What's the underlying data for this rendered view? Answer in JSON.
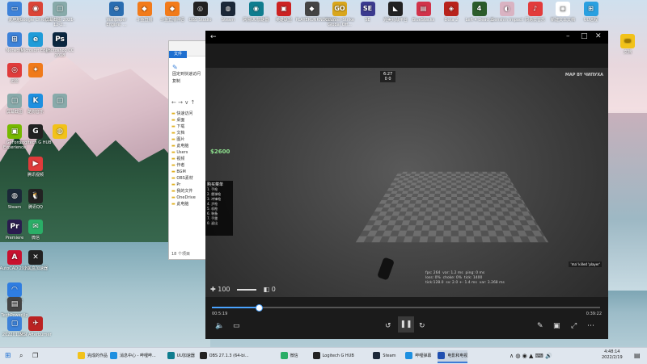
{
  "desktop": {
    "left_icons": [
      {
        "label": "此电脑",
        "color": "#3d82d9",
        "glyph": "▭"
      },
      {
        "label": "Google Chrome",
        "color": "#db4437",
        "glyph": "◉"
      },
      {
        "label": "屏幕截图 2021-12-2...",
        "color": "#8aa",
        "glyph": "▢"
      },
      {
        "label": "Network",
        "color": "#3d82d9",
        "glyph": "⊞"
      },
      {
        "label": "Microsoft Edge",
        "color": "#1f9cd9",
        "glyph": "e"
      },
      {
        "label": "Photoshop CC 2018",
        "color": "#0b2740",
        "glyph": "Ps"
      },
      {
        "label": "迅雷",
        "color": "#e03b3b",
        "glyph": "◎"
      },
      {
        "label": "屏幕截图",
        "color": "#8aa",
        "glyph": "▢"
      },
      {
        "label": "",
        "color": "#f07a1a",
        "glyph": "✦"
      },
      {
        "label": "酷狗音乐",
        "color": "#1e90e0",
        "glyph": "K"
      },
      {
        "label": "",
        "color": "#8aa",
        "glyph": "▢"
      },
      {
        "label": "GeForce Experience",
        "color": "#76b900",
        "glyph": "▣"
      },
      {
        "label": "",
        "color": "#f2c21a",
        "glyph": "◍"
      },
      {
        "label": "腾讯视频",
        "color": "#e03b3b",
        "glyph": "▶"
      },
      {
        "label": "Logitech G HUB",
        "color": "#222",
        "glyph": "G"
      },
      {
        "label": "Steam",
        "color": "#1b2838",
        "glyph": "◍"
      },
      {
        "label": "腾讯QQ",
        "color": "#222",
        "glyph": "🐧"
      },
      {
        "label": "Premiere",
        "color": "#2a1c4f",
        "glyph": "Pr"
      },
      {
        "label": "微信",
        "color": "#2aae67",
        "glyph": "✉"
      },
      {
        "label": "AutoCAD 2020",
        "color": "#c8102e",
        "glyph": "A"
      },
      {
        "label": "小黑盒加速器",
        "color": "#222",
        "glyph": "✕"
      },
      {
        "label": "百度网盘",
        "color": "#2f7de1",
        "glyph": "◠"
      },
      {
        "label": "TechPowerUp GPU-Z",
        "color": "#444",
        "glyph": "▤"
      },
      {
        "label": "20220119...",
        "color": "#3d82d9",
        "glyph": "▢"
      },
      {
        "label": "MSI Afterburner",
        "color": "#b22",
        "glyph": "✈"
      }
    ],
    "top_icons": [
      {
        "label": "Wallpaper Engine: ...",
        "color": "#2a6db0",
        "glyph": "⊕"
      },
      {
        "label": "斗鱼直播",
        "color": "#f27b1a",
        "glyph": "◆"
      },
      {
        "label": "斗鱼直播伴侣",
        "color": "#f27b1a",
        "glyph": "◆"
      },
      {
        "label": "OBS Studio",
        "color": "#222",
        "glyph": "◎"
      },
      {
        "label": "Steam",
        "color": "#1b2838",
        "glyph": "◍"
      },
      {
        "label": "网易UU加速器",
        "color": "#0f7d8f",
        "glyph": "◉"
      },
      {
        "label": "英雄联盟",
        "color": "#c22",
        "glyph": "▣"
      },
      {
        "label": "PLAYERUNKNOWN'S",
        "color": "#444",
        "glyph": "◆"
      },
      {
        "label": "Counter-Strike Global Off...",
        "color": "#d9a61c",
        "glyph": "GO"
      },
      {
        "label": "SE",
        "color": "#3b3b8f",
        "glyph": "SE"
      },
      {
        "label": "完美对战平台",
        "color": "#222",
        "glyph": "◣"
      },
      {
        "label": "BlueStacks",
        "color": "#d1334a",
        "glyph": "▤"
      },
      {
        "label": "Dota 2",
        "color": "#b8231c",
        "glyph": "◈"
      },
      {
        "label": "Left 4 Dead 2",
        "color": "#2b5c2b",
        "glyph": "4"
      },
      {
        "label": "Genshin Impact",
        "color": "#d9b3c2",
        "glyph": "◐"
      },
      {
        "label": "网易云音乐",
        "color": "#e23b3b",
        "glyph": "♪"
      },
      {
        "label": "新建文本文档",
        "color": "#fff",
        "glyph": "▢"
      },
      {
        "label": "UU远程",
        "color": "#2aa0e0",
        "glyph": "⊞"
      }
    ],
    "right_icon": {
      "label": "文档",
      "color": "#f2c21a",
      "glyph": "▬"
    }
  },
  "explorer": {
    "tab_label": "文件",
    "ribbon_items": [
      "固定到快速访问",
      "复制"
    ],
    "tree": [
      "快速访问",
      "桌面",
      "下载",
      "文档",
      "图片",
      "此电脑",
      "Users",
      "视频",
      "作者",
      "BGM",
      "OBS素材",
      "Pr",
      "我的文件",
      "OneDrive",
      "此电脑"
    ],
    "status": "18 个项目"
  },
  "player": {
    "hud_score": "6:27",
    "hud_score2": "0    0",
    "map_label": "MAP BY ЧИПУХА",
    "money": "$2600",
    "health": "100",
    "ammo": "0",
    "menu_title": "购买菜单",
    "menu_items": [
      "1. 手枪",
      "2. 霰弹枪",
      "3. 冲锋枪",
      "4. 步枪",
      "5. 机枪",
      "6. 装备",
      "7. 手雷",
      "0. 退出"
    ],
    "kill_label": "'ma' killed 'player'",
    "netgraph": "fps: 264  var: 1.2 ms  ping: 0 ms\nloss: 0%  choke: 0%  tick: 1400\ntick:128.0  sv: 2.0 +- 1.4 ms  var: 3.268 ms",
    "time_elapsed": "00:5:19",
    "time_total": "0:39:22",
    "progress_fraction": 0.12
  },
  "taskbar": {
    "items": [
      {
        "label": "完成的作品",
        "color": "#f2c21a",
        "active": false
      },
      {
        "label": "消息中心 - 哔哩哔...",
        "color": "#1e90e0",
        "active": false
      },
      {
        "label": "UU加速器",
        "color": "#0f7d8f",
        "active": false
      },
      {
        "label": "OBS 27.1.3 (64-bi...",
        "color": "#222",
        "active": false
      },
      {
        "label": "微信",
        "color": "#2aae67",
        "active": false
      },
      {
        "label": "Logitech G HUB",
        "color": "#222",
        "active": false
      },
      {
        "label": "Steam",
        "color": "#1b2838",
        "active": false
      },
      {
        "label": "哔哩弹幕",
        "color": "#1e90e0",
        "active": false
      },
      {
        "label": "电影和电视",
        "color": "#1f4fb0",
        "active": true
      }
    ],
    "clock_time": "4:48:14",
    "clock_date": "2022/2/19"
  }
}
